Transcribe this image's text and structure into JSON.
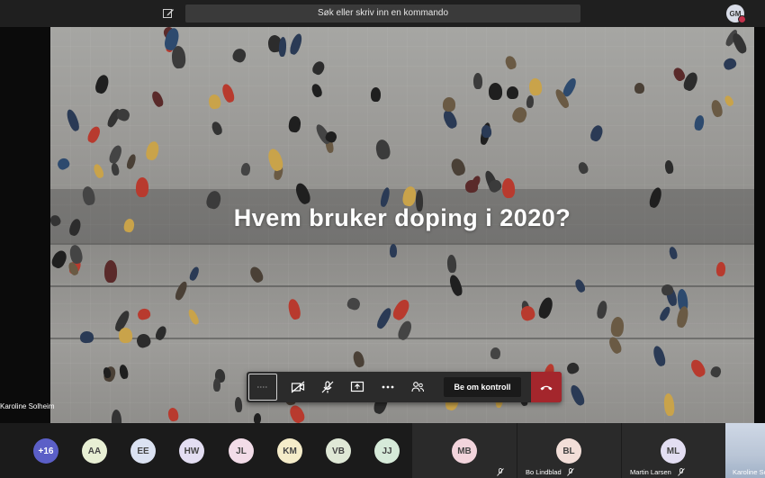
{
  "topbar": {
    "search_placeholder": "Søk eller skriv inn en kommando",
    "user_initials": "GM",
    "edit_icon": "compose-icon",
    "presence_color": "#c4314b"
  },
  "stage": {
    "slide_title": "Hvem bruker doping i 2020?",
    "presenter_name": "Karoline Solheim"
  },
  "controls": {
    "timer_icon": "call-timer-icon",
    "camera_icon": "camera-off-icon",
    "mic_icon": "mic-off-icon",
    "share_icon": "share-screen-icon",
    "more_icon": "more-options-icon",
    "participants_icon": "participants-icon",
    "take_control_label": "Be om kontroll",
    "hangup_icon": "hang-up-icon",
    "hangup_color": "#a4262c"
  },
  "participants": {
    "overflow_label": "+16",
    "avatars": [
      {
        "initials": "AA",
        "color": "#e8efd4"
      },
      {
        "initials": "EE",
        "color": "#dbe2f2"
      },
      {
        "initials": "HW",
        "color": "#e3def2"
      },
      {
        "initials": "JL",
        "color": "#f2dce8"
      },
      {
        "initials": "KM",
        "color": "#f5ecc9"
      },
      {
        "initials": "VB",
        "color": "#dfe8d6"
      },
      {
        "initials": "JJ",
        "color": "#d6ead9"
      }
    ],
    "tiles": [
      {
        "initials": "MB",
        "name": "",
        "color": "#f2d4dc"
      },
      {
        "initials": "BL",
        "name": "Bo Lindblad",
        "color": "#f2ded8"
      },
      {
        "initials": "ML",
        "name": "Martin Larsen",
        "color": "#e3def2"
      }
    ],
    "self_name": "Karoline Solheim"
  }
}
